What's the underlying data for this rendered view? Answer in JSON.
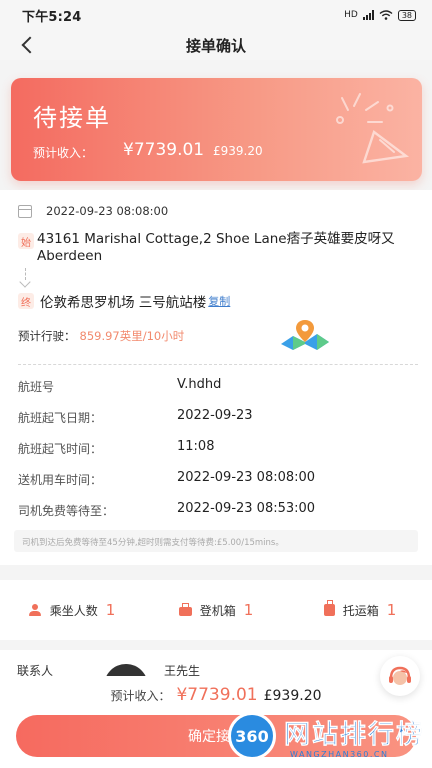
{
  "status_bar": {
    "time": "下午5:24",
    "indicators": "HD",
    "battery": "38"
  },
  "nav": {
    "title": "接单确认"
  },
  "hero": {
    "state": "待接单",
    "income_label": "预计收入：",
    "income_cny": "¥7739.01",
    "income_gbp": "£939.20"
  },
  "trip": {
    "datetime": "2022-09-23 08:08:00",
    "start_badge": "始",
    "start_address": "43161 Marishal Cottage,2 Shoe Lane痞子英雄要皮呀又Aberdeen",
    "end_badge": "终",
    "end_address": "伦敦希思罗机场 三号航站楼",
    "copy_label": "复制",
    "estimate_label": "预计行驶：",
    "estimate_value": "859.97英里/10小时"
  },
  "fields": [
    {
      "label": "航班号",
      "value": "V.hdhd"
    },
    {
      "label": "航班起飞日期：",
      "value": "2022-09-23"
    },
    {
      "label": "航班起飞时间：",
      "value": "11:08"
    },
    {
      "label": "送机用车时间：",
      "value": "2022-09-23 08:08:00"
    },
    {
      "label": "司机免费等待至：",
      "value": "2022-09-23 08:53:00"
    }
  ],
  "note": "司机到达后免费等待至45分钟,超时则需支付等待费:£5.00/15mins。",
  "counts": [
    {
      "icon": "person-icon",
      "label": "乘坐人数",
      "value": "1"
    },
    {
      "icon": "suitcase-icon",
      "label": "登机箱",
      "value": "1"
    },
    {
      "icon": "luggage-icon",
      "label": "托运箱",
      "value": "1"
    }
  ],
  "contact": {
    "label": "联系人",
    "name": "王先生"
  },
  "bottom": {
    "income_label": "预计收入：",
    "income_cny": "¥7739.01",
    "income_gbp": "£939.20",
    "confirm_label": "确定接单"
  },
  "watermark": {
    "number": "360",
    "title": "网站排行榜",
    "subtitle": "WANGZHAN360.CN"
  },
  "colors": {
    "accent": "#f0705a",
    "link": "#3d7ccc"
  }
}
